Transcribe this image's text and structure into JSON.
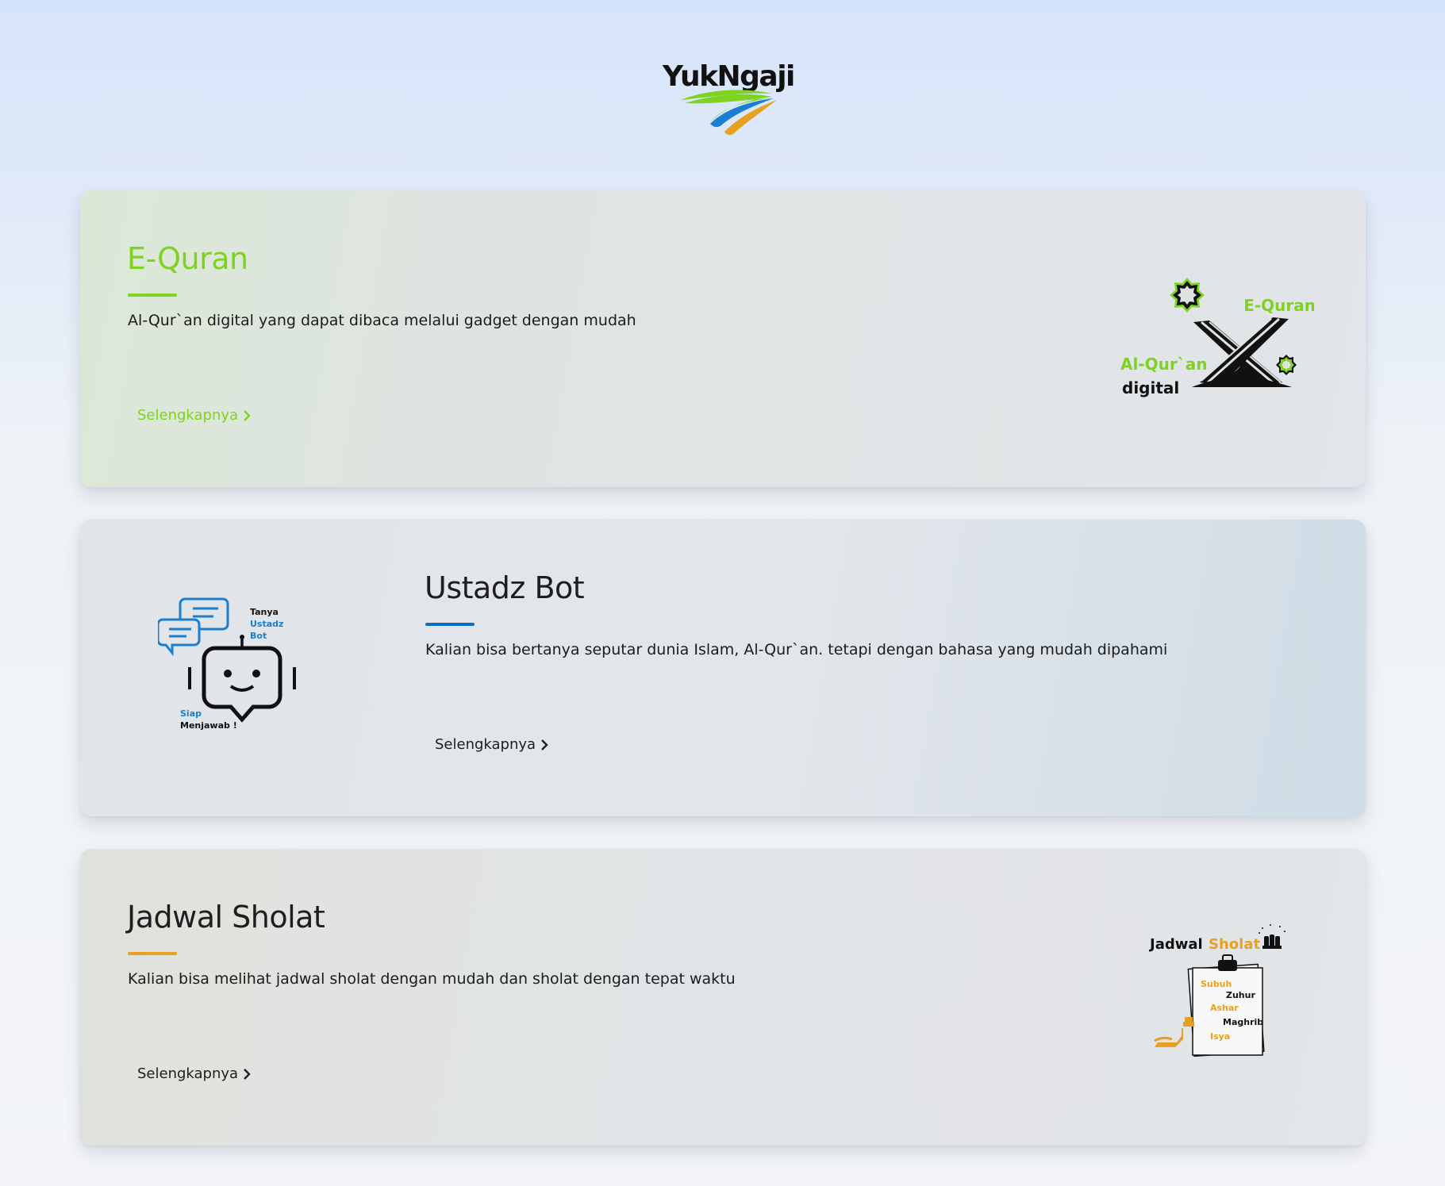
{
  "brand": {
    "logo_text": "YukNgaji",
    "colors": {
      "green": "#7ed321",
      "blue": "#0a6fc2",
      "orange": "#e8a020"
    }
  },
  "cards": [
    {
      "title": "E-Quran",
      "description": "Al-Qur`an digital yang dapat dibaca melalui gadget dengan mudah",
      "link_label": "Selengkapnya",
      "accent": "#7ed321",
      "illustration": {
        "icon": "open-quran-rehal-icon",
        "label_top": "E-Quran",
        "label_line1": "Al-Qur`an",
        "label_line2": "digital"
      }
    },
    {
      "title": "Ustadz Bot",
      "description": "Kalian bisa bertanya seputar dunia Islam, Al-Qur`an. tetapi dengan bahasa yang mudah dipahami",
      "link_label": "Selengkapnya",
      "accent": "#0a6fc2",
      "illustration": {
        "icon": "chat-robot-icon",
        "label_1": "Tanya",
        "label_2": "Ustadz",
        "label_3": "Bot",
        "label_4": "Siap",
        "label_5": "Menjawab !"
      }
    },
    {
      "title": "Jadwal Sholat",
      "description": "Kalian bisa melihat jadwal sholat dengan mudah dan sholat dengan tepat waktu",
      "link_label": "Selengkapnya",
      "accent": "#e8a020",
      "illustration": {
        "icon": "prayer-schedule-clipboard-icon",
        "title_1": "Jadwal",
        "title_2": "Sholat",
        "times": [
          "Subuh",
          "Zuhur",
          "Ashar",
          "Maghrib",
          "Isya"
        ]
      }
    }
  ]
}
